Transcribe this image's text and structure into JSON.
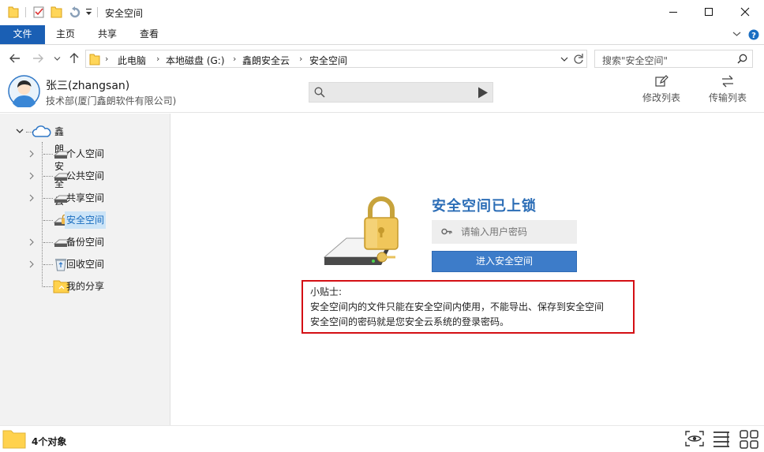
{
  "window": {
    "title": "安全空间"
  },
  "ribbon": {
    "tabs": [
      {
        "label": "文件"
      },
      {
        "label": "主页"
      },
      {
        "label": "共享"
      },
      {
        "label": "查看"
      }
    ]
  },
  "address": {
    "crumbs": [
      "此电脑",
      "本地磁盘 (G:)",
      "鑫朗安全云",
      "安全空间"
    ],
    "search_placeholder": "搜索\"安全空间\""
  },
  "user": {
    "name": "张三(zhangsan)",
    "dept": "技术部(厦门鑫朗软件有限公司)"
  },
  "tools": {
    "edit_list": "修改列表",
    "transfer_list": "传输列表"
  },
  "tree": {
    "root": "鑫朗安全云",
    "items": [
      {
        "label": "个人空间"
      },
      {
        "label": "公共空间"
      },
      {
        "label": "共享空间"
      },
      {
        "label": "安全空间"
      },
      {
        "label": "备份空间"
      },
      {
        "label": "回收空间"
      },
      {
        "label": "我的分享"
      }
    ]
  },
  "locked": {
    "title": "安全空间已上锁",
    "password_placeholder": "请输入用户密码",
    "enter_button": "进入安全空间",
    "tips_title": "小贴士:",
    "tips_line1": "安全空间内的文件只能在安全空间内使用，不能导出、保存到安全空间",
    "tips_line2": "安全空间的密码就是您安全云系统的登录密码。"
  },
  "status": {
    "count": "4个对象"
  },
  "colors": {
    "accent": "#1a5fb4",
    "button": "#3d7cc9",
    "tips_border": "#d40f14",
    "title": "#2b6db6"
  }
}
